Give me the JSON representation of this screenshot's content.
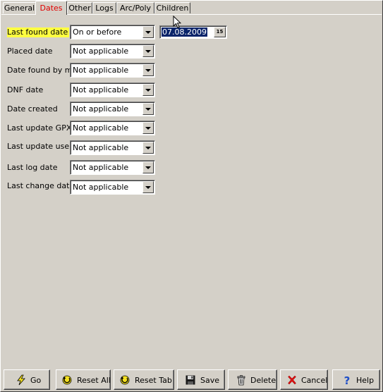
{
  "tabs": [
    {
      "label": "General"
    },
    {
      "label": "Dates",
      "active": true
    },
    {
      "label": "Other"
    },
    {
      "label": "Logs"
    },
    {
      "label": "Arc/Poly"
    },
    {
      "label": "Children"
    }
  ],
  "rows": [
    {
      "label": "Last found date",
      "value": "On or before",
      "highlighted": true
    },
    {
      "label": "Placed date",
      "value": "Not applicable"
    },
    {
      "label": "Date found by me",
      "value": "Not applicable"
    },
    {
      "label": "DNF date",
      "value": "Not applicable"
    },
    {
      "label": "Date created",
      "value": "Not applicable"
    },
    {
      "label": "Last update GPX",
      "value": "Not applicable"
    },
    {
      "label": "Last update user",
      "value": "Not applicable"
    },
    {
      "label": "Last log date",
      "value": "Not applicable"
    },
    {
      "label": "Last change date",
      "value": "Not applicable"
    }
  ],
  "date_picker": {
    "value": "07.08.2009",
    "calendar_glyph": "15"
  },
  "buttons": [
    {
      "label": "Go",
      "icon": "lightning-icon"
    },
    {
      "label": "Reset All",
      "icon": "reset-icon"
    },
    {
      "label": "Reset Tab",
      "icon": "reset-icon"
    },
    {
      "label": "Save",
      "icon": "floppy-disk-icon"
    },
    {
      "label": "Delete",
      "icon": "trash-can-icon"
    },
    {
      "label": "Cancel",
      "icon": "red-x-icon"
    },
    {
      "label": "Help",
      "icon": "question-mark-icon"
    }
  ],
  "colors": {
    "face": "#d4d0c8",
    "active_tab_text": "#e00000",
    "highlight": "#ffff40",
    "selection": "#0a246a"
  }
}
